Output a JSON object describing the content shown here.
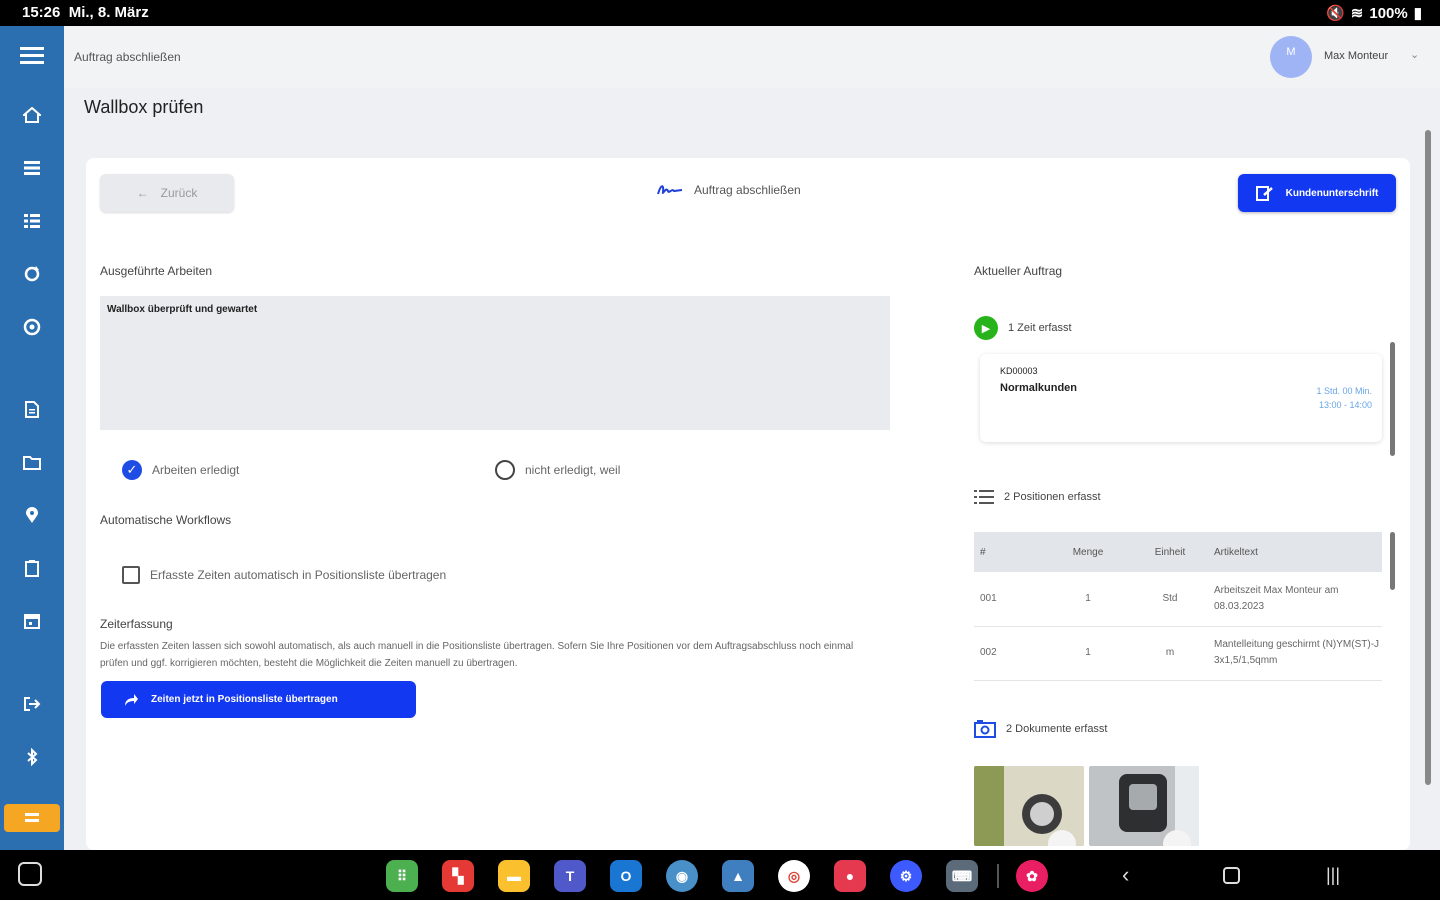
{
  "status": {
    "time": "15:26",
    "date": "Mi., 8. März",
    "battery": "100%"
  },
  "topbar": {
    "breadcrumb": "Auftrag abschließen",
    "avatar_initial": "M",
    "username": "Max Monteur",
    "chevron": "⌄"
  },
  "page_title": "Wallbox prüfen",
  "toolbar": {
    "back_label": "Zurück",
    "center_title": "Auftrag abschließen",
    "signature_label": "Kundenunterschrift"
  },
  "form": {
    "worked_label": "Ausgeführte Arbeiten",
    "worked_text": "Wallbox überprüft und gewartet",
    "radio_done": "Arbeiten erledigt",
    "radio_not_done": "nicht erledigt, weil",
    "workflows_label": "Automatische Workflows",
    "checkbox_label": "Erfasste Zeiten automatisch in Positionsliste übertragen",
    "time_label": "Zeiterfassung",
    "time_desc": "Die erfassten Zeiten lassen sich sowohl automatisch, als auch manuell in die Positionsliste übertragen. Sofern Sie Ihre Positionen vor dem Auftragsabschluss noch einmal prüfen und ggf. korrigieren möchten, besteht die Möglichkeit die Zeiten manuell zu übertragen.",
    "transfer_button": "Zeiten jetzt in Positionsliste übertragen"
  },
  "current_order": {
    "title": "Aktueller Auftrag",
    "time_count": "1 Zeit erfasst",
    "card": {
      "number": "KD00003",
      "customer": "Normalkunden",
      "time1": "1 Std. 00 Min.",
      "time2": "13:00 - 14:00"
    },
    "positions_count": "2 Positionen erfasst",
    "table_headers": [
      "#",
      "Menge",
      "Einheit",
      "Artikeltext"
    ],
    "rows": [
      {
        "num": "001",
        "qty": "1",
        "unit": "Std",
        "text": "Arbeitszeit Max Monteur am 08.03.2023"
      },
      {
        "num": "002",
        "qty": "1",
        "unit": "m",
        "text": "Mantelleitung geschirmt (N)YM(ST)-J 3x1,5/1,5qmm"
      }
    ],
    "documents_count": "2 Dokumente erfasst"
  },
  "sidebar_icons": [
    "menu-icon",
    "home-icon",
    "list-icon",
    "checklist-icon",
    "sync-icon",
    "settings-icon",
    "document-icon",
    "folder-icon",
    "location-icon",
    "notes-icon",
    "calendar-icon",
    "logout-icon",
    "bluetooth-icon",
    "badge-icon"
  ],
  "taskbar_apps": [
    "apps-grid",
    "flipboard",
    "folder",
    "teams",
    "outlook",
    "web",
    "gallery",
    "chrome",
    "screen-recorder",
    "settings",
    "keyboard",
    "bixby"
  ],
  "colors": {
    "sidebar": "#2c6fb1",
    "primary": "#1338f2",
    "success": "#28b31c",
    "accent": "#f5a623"
  }
}
